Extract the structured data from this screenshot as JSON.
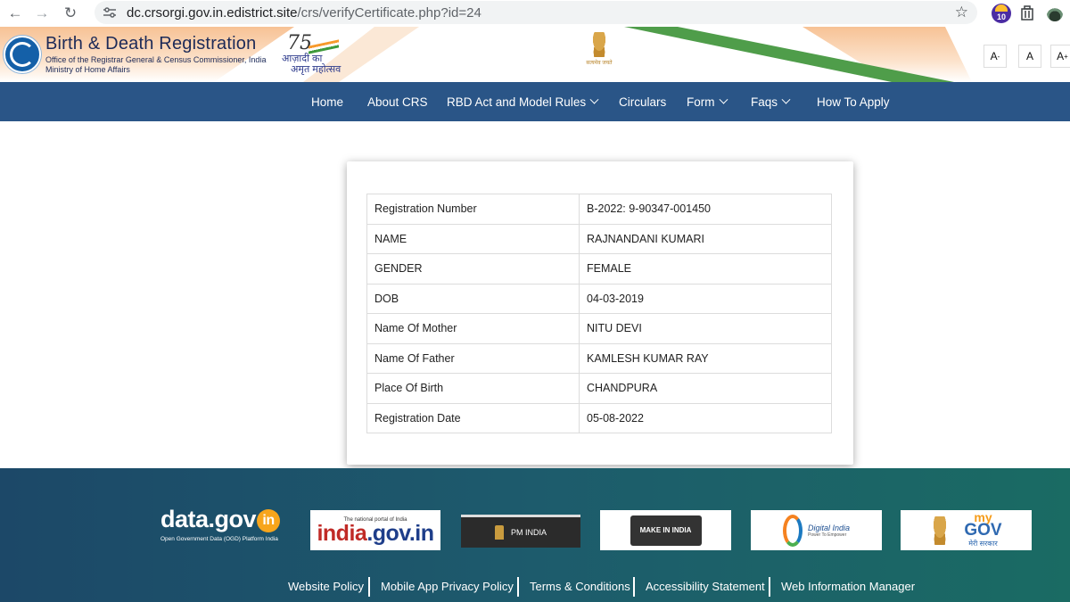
{
  "browser": {
    "url_host": "dc.crsorgi.gov.in.edistrict.site",
    "url_path": "/crs/verifyCertificate.php?id=24",
    "extension_badge": "10"
  },
  "header": {
    "title": "Birth & Death Registration",
    "subtitle1": "Office of the Registrar General & Census Commissioner, India",
    "subtitle2": "Ministry of Home Affairs",
    "azadi_75": "75",
    "azadi_line1": "आज़ादी का",
    "azadi_line2": "अमृत महोत्सव",
    "emblem_text": "सत्यमेव जयते",
    "font_controls": [
      "A",
      "A",
      "A"
    ],
    "font_small_sup": "-",
    "font_large_sup": "+"
  },
  "nav": {
    "items": [
      {
        "label": "Home",
        "dropdown": false
      },
      {
        "label": "About CRS",
        "dropdown": false
      },
      {
        "label": "RBD Act and Model Rules",
        "dropdown": true
      },
      {
        "label": "Circulars",
        "dropdown": false
      },
      {
        "label": "Form",
        "dropdown": true
      },
      {
        "label": "Faqs",
        "dropdown": true
      },
      {
        "label": "How To Apply",
        "dropdown": false
      }
    ]
  },
  "certificate": {
    "rows": [
      {
        "label": "Registration Number",
        "value": "B-2022: 9-90347-001450"
      },
      {
        "label": "NAME",
        "value": "RAJNANDANI KUMARI"
      },
      {
        "label": "GENDER",
        "value": "FEMALE"
      },
      {
        "label": "DOB",
        "value": "04-03-2019"
      },
      {
        "label": "Name Of Mother",
        "value": "NITU DEVI"
      },
      {
        "label": "Name Of Father",
        "value": "KAMLESH KUMAR RAY"
      },
      {
        "label": "Place Of Birth",
        "value": "CHANDPURA"
      },
      {
        "label": "Registration Date",
        "value": "05-08-2022"
      }
    ]
  },
  "footer": {
    "datagov_title": "data.gov",
    "datagov_in": "in",
    "datagov_sub": "Open Government Data (OGD) Platform India",
    "india_small": "The national portal of India",
    "india_big_a": "india",
    "india_big_b": ".gov.in",
    "pm_india": "PM INDIA",
    "make_in_india": "MAKE IN INDIA",
    "digital_india": "Digital India",
    "digital_india_sub": "Power To Empower",
    "mygov_my": "my",
    "mygov_gov": "GOV",
    "mygov_hi": "मेरी सरकार",
    "links": [
      "Website Policy",
      "Mobile App Privacy Policy",
      "Terms & Conditions",
      "Accessibility Statement",
      "Web Information Manager"
    ]
  }
}
